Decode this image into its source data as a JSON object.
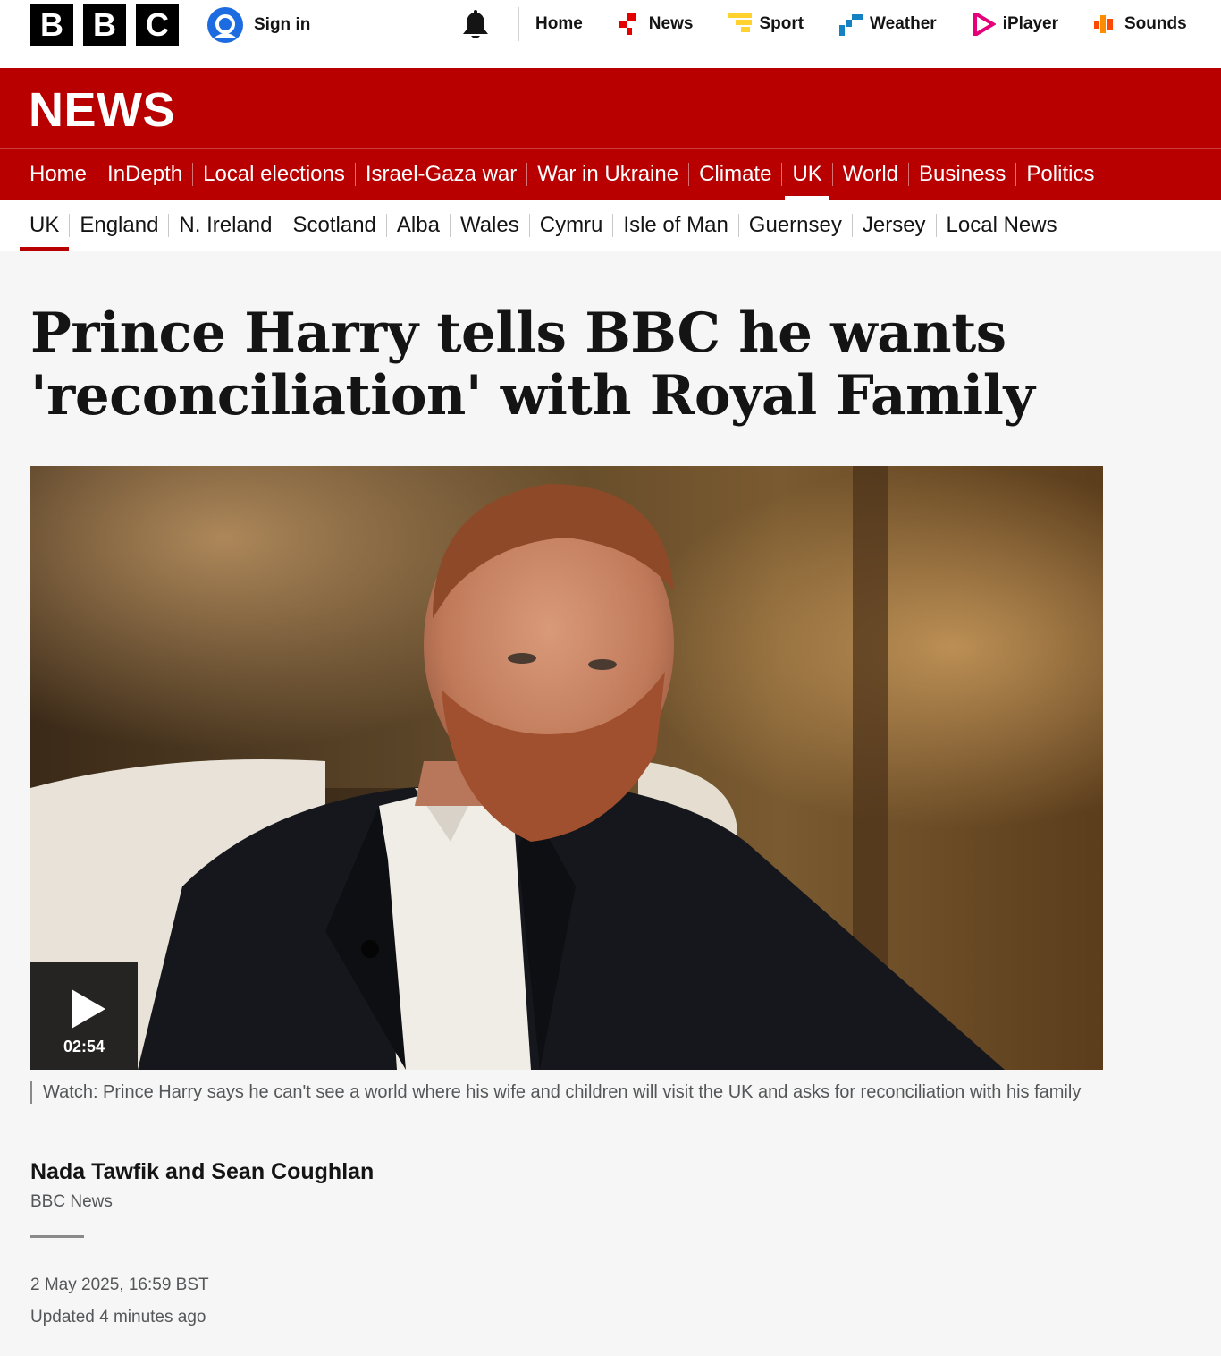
{
  "brand": {
    "letters": [
      "B",
      "B",
      "C"
    ],
    "news": "NEWS"
  },
  "account": {
    "signin_label": "Sign in"
  },
  "global_nav": [
    {
      "label": "Home",
      "icon": "none"
    },
    {
      "label": "News",
      "icon": "news-icon",
      "color": "#e50000"
    },
    {
      "label": "Sport",
      "icon": "sport-icon",
      "color": "#ffd230"
    },
    {
      "label": "Weather",
      "icon": "weather-icon",
      "color": "#1381c2"
    },
    {
      "label": "iPlayer",
      "icon": "iplayer-icon",
      "color": "#e50079"
    },
    {
      "label": "Sounds",
      "icon": "sounds-icon",
      "color": "#ff4800"
    }
  ],
  "section_nav": {
    "items": [
      "Home",
      "InDepth",
      "Local elections",
      "Israel-Gaza war",
      "War in Ukraine",
      "Climate",
      "UK",
      "World",
      "Business",
      "Politics"
    ],
    "active": "UK"
  },
  "sub_nav": {
    "items": [
      "UK",
      "England",
      "N. Ireland",
      "Scotland",
      "Alba",
      "Wales",
      "Cymru",
      "Isle of Man",
      "Guernsey",
      "Jersey",
      "Local News"
    ],
    "active": "UK"
  },
  "article": {
    "headline": "Prince Harry tells BBC he wants 'reconciliation' with Royal Family",
    "video": {
      "duration": "02:54",
      "caption": "Watch: Prince Harry says he can't see a world where his wife and children will visit the UK and asks for reconciliation with his family"
    },
    "byline": {
      "authors": "Nada Tawfik and Sean Coughlan",
      "org": "BBC News"
    },
    "published": "2 May 2025, 16:59 BST",
    "updated": "Updated 4 minutes ago"
  },
  "colors": {
    "news_red": "#b80000",
    "signin_blue": "#1d6be0",
    "text": "#141414",
    "muted": "#545658"
  }
}
